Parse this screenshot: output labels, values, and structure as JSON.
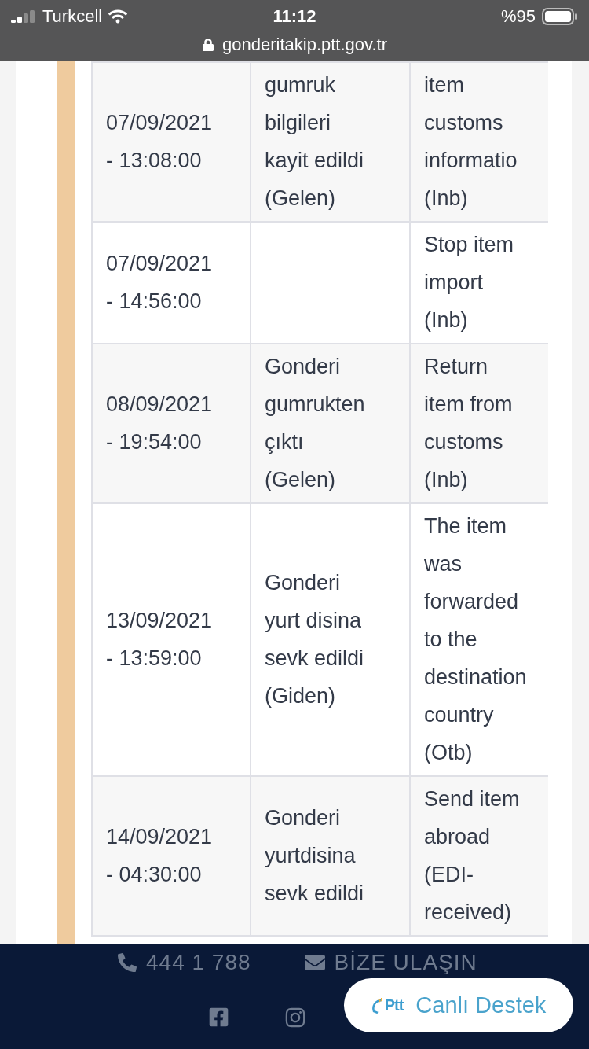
{
  "status_bar": {
    "carrier": "Turkcell",
    "time": "11:12",
    "battery": "%95",
    "url": "gonderitakip.ptt.gov.tr"
  },
  "tracking_table": {
    "rows": [
      {
        "column_1": "07/09/2021 - 13:08:00",
        "column_2": "gumruk bilgileri kayit edildi (Gelen)",
        "column_3": "item customs informatio (Inb)"
      },
      {
        "column_1": "07/09/2021 - 14:56:00",
        "column_3": "Stop item import (Inb)"
      },
      {
        "column_1": "08/09/2021 - 19:54:00",
        "column_2": "Gonderi gumrukten çıktı (Gelen)",
        "column_3": "Return item from customs (Inb)"
      },
      {
        "column_1": "13/09/2021 - 13:59:00",
        "column_2": "Gonderi yurt disina sevk edildi (Giden)",
        "column_3": "The item was forwarded to the destination country (Otb)"
      },
      {
        "column_1": "14/09/2021 - 04:30:00",
        "column_2": "Gonderi yurtdisina sevk edildi",
        "column_3": "Send item abroad (EDI- received)"
      }
    ]
  },
  "footer": {
    "phone": "444 1 788",
    "contact": "BİZE ULAŞIN",
    "live_chat": {
      "logo_text": "Ptt",
      "label": "Canlı Destek"
    }
  }
}
